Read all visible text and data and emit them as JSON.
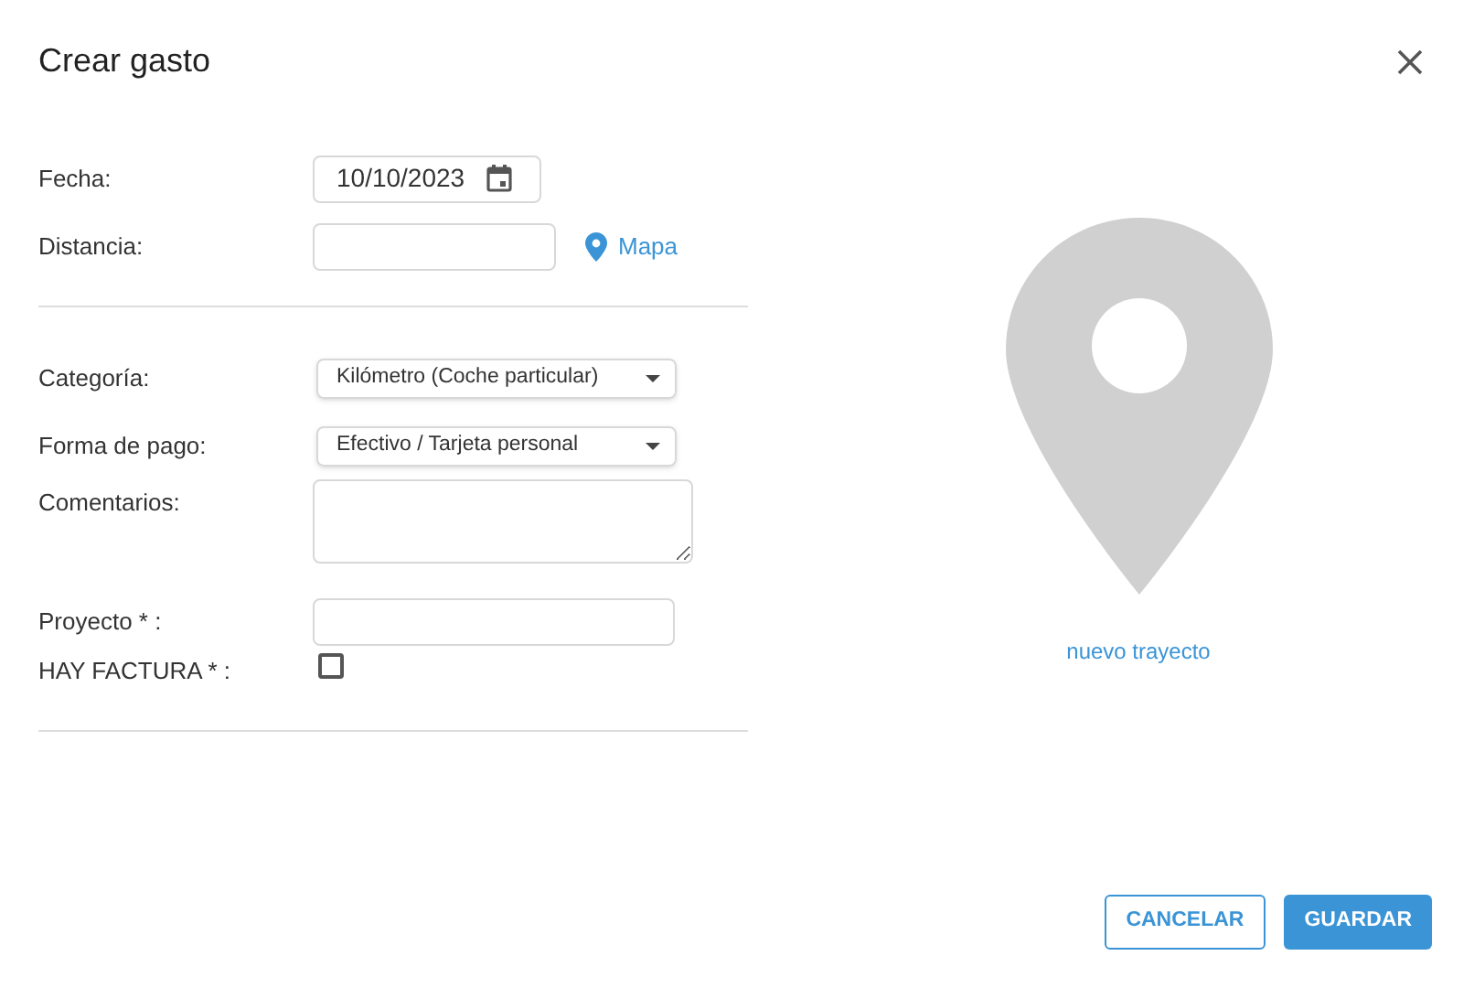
{
  "dialog": {
    "title": "Crear gasto"
  },
  "section_1": [
    {
      "kind": "date",
      "label": "Fecha:",
      "value": "10/10/2023"
    },
    {
      "kind": "text",
      "label": "Distancia:",
      "link": "Mapa"
    }
  ],
  "section_2": [
    {
      "kind": "select",
      "label": "Categoría:",
      "value": "Kilómetro (Coche particular)"
    },
    {
      "kind": "select",
      "label": "Forma de pago:",
      "value": "Efectivo / Tarjeta personal"
    },
    {
      "kind": "textarea",
      "label": "Comentarios:"
    },
    {
      "kind": "text",
      "label": "Proyecto * :"
    },
    {
      "kind": "checkbox",
      "label": "HAY FACTURA * :",
      "checked": false
    }
  ],
  "route": {
    "link": "nuevo trayecto"
  },
  "buttons": [
    {
      "kind": "secondary",
      "label": "CANCELAR"
    },
    {
      "kind": "primary",
      "label": "GUARDAR"
    }
  ]
}
